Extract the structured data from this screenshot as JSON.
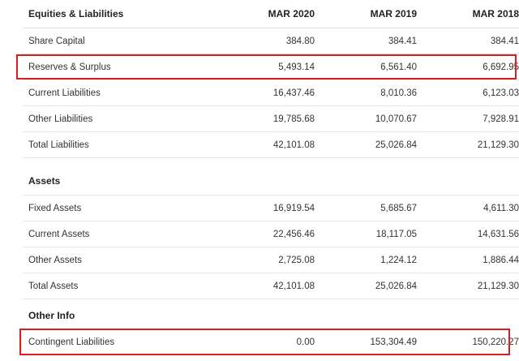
{
  "header": {
    "label": "Equities & Liabilities",
    "col1": "MAR 2020",
    "col2": "MAR 2019",
    "col3": "MAR 2018"
  },
  "liabilities": [
    {
      "label": "Share Capital",
      "values": [
        "384.80",
        "384.41",
        "384.41"
      ],
      "highlighted": false
    },
    {
      "label": "Reserves & Surplus",
      "values": [
        "5,493.14",
        "6,561.40",
        "6,692.95"
      ],
      "highlighted": true
    },
    {
      "label": "Current Liabilities",
      "values": [
        "16,437.46",
        "8,010.36",
        "6,123.03"
      ],
      "highlighted": false
    },
    {
      "label": "Other Liabilities",
      "values": [
        "19,785.68",
        "10,070.67",
        "7,928.91"
      ],
      "highlighted": false
    },
    {
      "label": "Total Liabilities",
      "values": [
        "42,101.08",
        "25,026.84",
        "21,129.30"
      ],
      "highlighted": false
    }
  ],
  "assets_section": {
    "label": "Assets"
  },
  "assets": [
    {
      "label": "Fixed Assets",
      "values": [
        "16,919.54",
        "5,685.67",
        "4,611.30"
      ]
    },
    {
      "label": "Current Assets",
      "values": [
        "22,456.46",
        "18,117.05",
        "14,631.56"
      ]
    },
    {
      "label": "Other Assets",
      "values": [
        "2,725.08",
        "1,224.12",
        "1,886.44"
      ]
    },
    {
      "label": "Total Assets",
      "values": [
        "42,101.08",
        "25,026.84",
        "21,129.30"
      ]
    }
  ],
  "other_info_section": {
    "label": "Other Info"
  },
  "other_info": [
    {
      "label": "Contingent Liabilities",
      "values": [
        "0.00",
        "153,304.49",
        "150,220.27"
      ],
      "highlighted": true
    }
  ],
  "colors": {
    "highlight_border": "#d81e1e",
    "row_border": "#e6e6e6",
    "text": "#333333"
  }
}
